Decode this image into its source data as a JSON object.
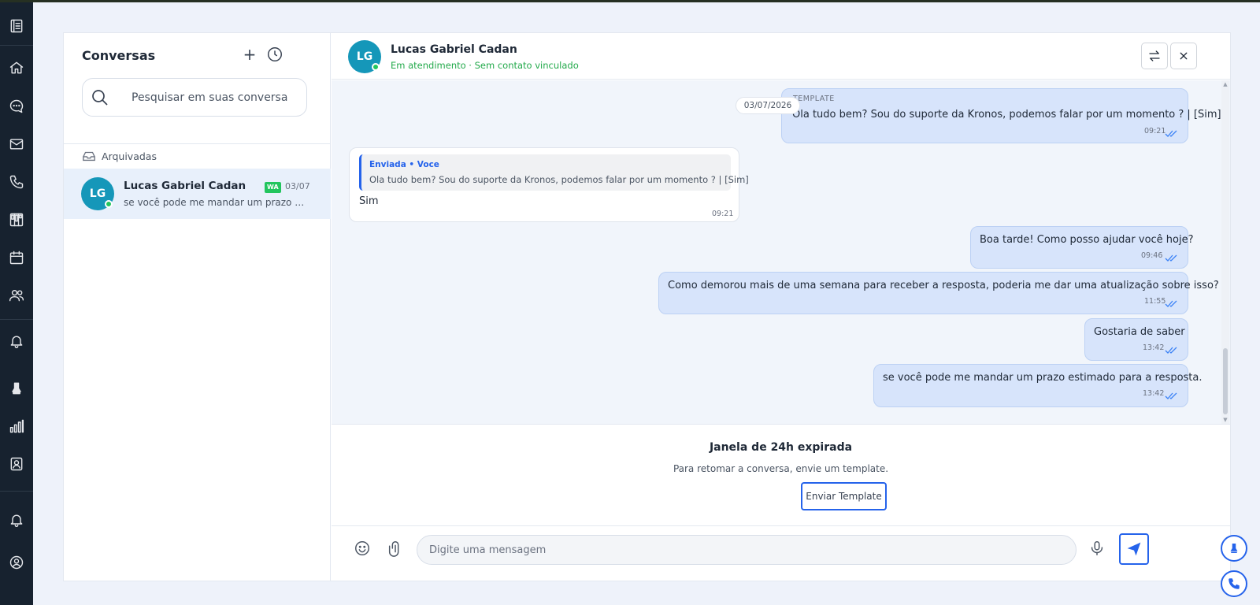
{
  "colors": {
    "rail": "#17222f",
    "accent": "#2563eb",
    "avatar": "#1597b9",
    "online": "#22c55e",
    "outgoing_bubble": "#d7e4fb",
    "status_text": "#22a94a"
  },
  "rail": {
    "icons": [
      "menu-book-icon",
      "home-icon",
      "chat-icon",
      "mail-icon",
      "phone-icon",
      "kanban-icon",
      "calendar-icon",
      "users-icon",
      "bell-icon",
      "bell-filled-icon",
      "bar-chart-icon",
      "contact-card-icon",
      "notifications-icon",
      "profile-icon"
    ]
  },
  "sidebar": {
    "title": "Conversas",
    "new_label": "+",
    "search_placeholder": "Pesquisar em suas conversa",
    "archived_label": "Arquivadas",
    "conversations": [
      {
        "initials": "LG",
        "name": "Lucas Gabriel Cadan",
        "channel_badge": "WA",
        "date": "03/07",
        "preview": "se você pode me mandar um prazo estimado para a resposta."
      }
    ]
  },
  "chat": {
    "contact": {
      "initials": "LG",
      "name": "Lucas Gabriel Cadan",
      "status": "Em atendimento · Sem contato vinculado"
    },
    "date_separator": "03/07/2026",
    "messages": [
      {
        "direction": "out",
        "label": "TEMPLATE",
        "text": "Ola tudo bem? Sou do suporte da Kronos, podemos falar por um momento ? | [Sim]",
        "time": "09:21"
      },
      {
        "direction": "in",
        "reply_header": "Enviada • Voce",
        "reply_text": "Ola tudo bem? Sou do suporte da Kronos, podemos falar por um momento ? | [Sim]",
        "text": "Sim",
        "time": "09:21"
      },
      {
        "direction": "out",
        "text": "Boa tarde! Como posso ajudar você hoje?",
        "time": "09:46"
      },
      {
        "direction": "out",
        "text": "Como demorou mais de uma semana para receber a resposta, poderia me dar uma atualização sobre isso?",
        "time": "11:55"
      },
      {
        "direction": "out",
        "text": "Gostaria de saber",
        "time": "13:42"
      },
      {
        "direction": "out",
        "text": "se você pode me mandar um prazo estimado para a resposta.",
        "time": "13:42"
      }
    ],
    "expired": {
      "title": "Janela de 24h expirada",
      "subtitle": "Para retomar a conversa, envie um template.",
      "button": "Enviar Template"
    },
    "composer": {
      "placeholder": "Digite uma mensagem"
    }
  }
}
